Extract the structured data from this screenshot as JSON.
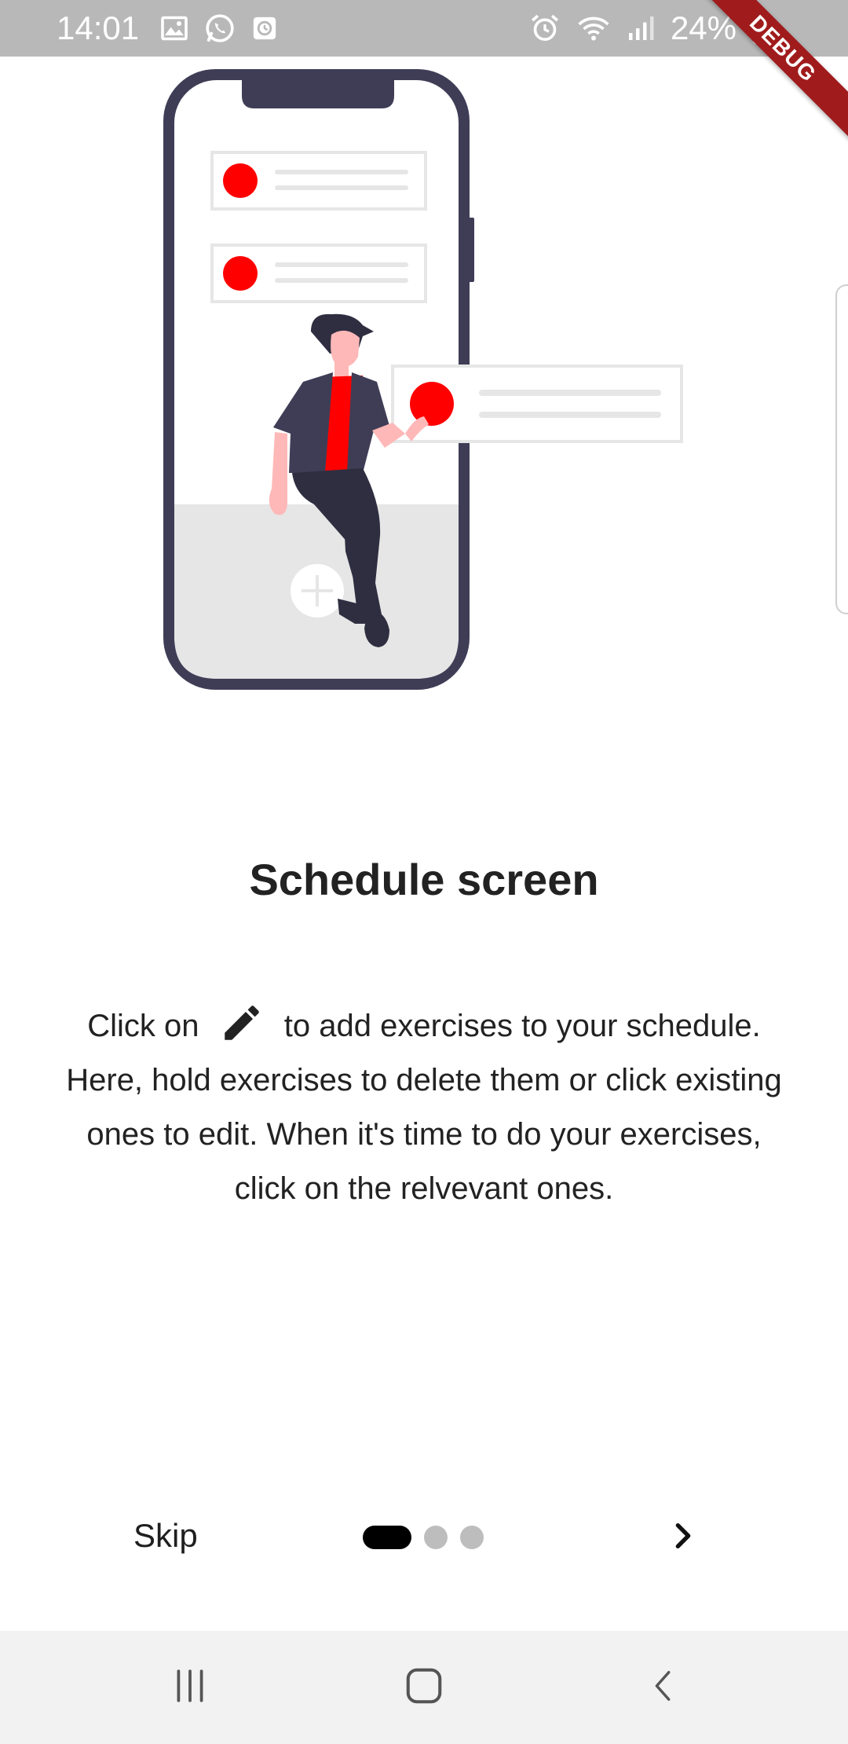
{
  "status_bar": {
    "time": "14:01",
    "battery": "24%",
    "left_icons": [
      "image-icon",
      "whatsapp-icon",
      "clock-app-icon"
    ],
    "right_icons": [
      "alarm-icon",
      "wifi-icon",
      "signal-icon",
      "battery-icon"
    ]
  },
  "debug_banner": "DEBUG",
  "page": {
    "title": "Schedule screen",
    "body_part1": "Click on",
    "body_icon": "pencil-icon",
    "body_part2": "to add exercises to your schedule. Here, hold exercises to delete them or click existing ones to edit. When it's time to do your exercises, click on the relvevant ones."
  },
  "onboarding_nav": {
    "skip_label": "Skip",
    "page_count": 3,
    "active_page": 1,
    "next_icon": "chevron-right-icon"
  },
  "colors": {
    "accent": "#ff0000",
    "phone_frame": "#3f3d56",
    "status_bar": "#b8b8b8",
    "debug_ribbon": "#a01c1c"
  },
  "system_nav": {
    "icons": [
      "recent-apps-icon",
      "home-icon",
      "back-icon"
    ]
  }
}
